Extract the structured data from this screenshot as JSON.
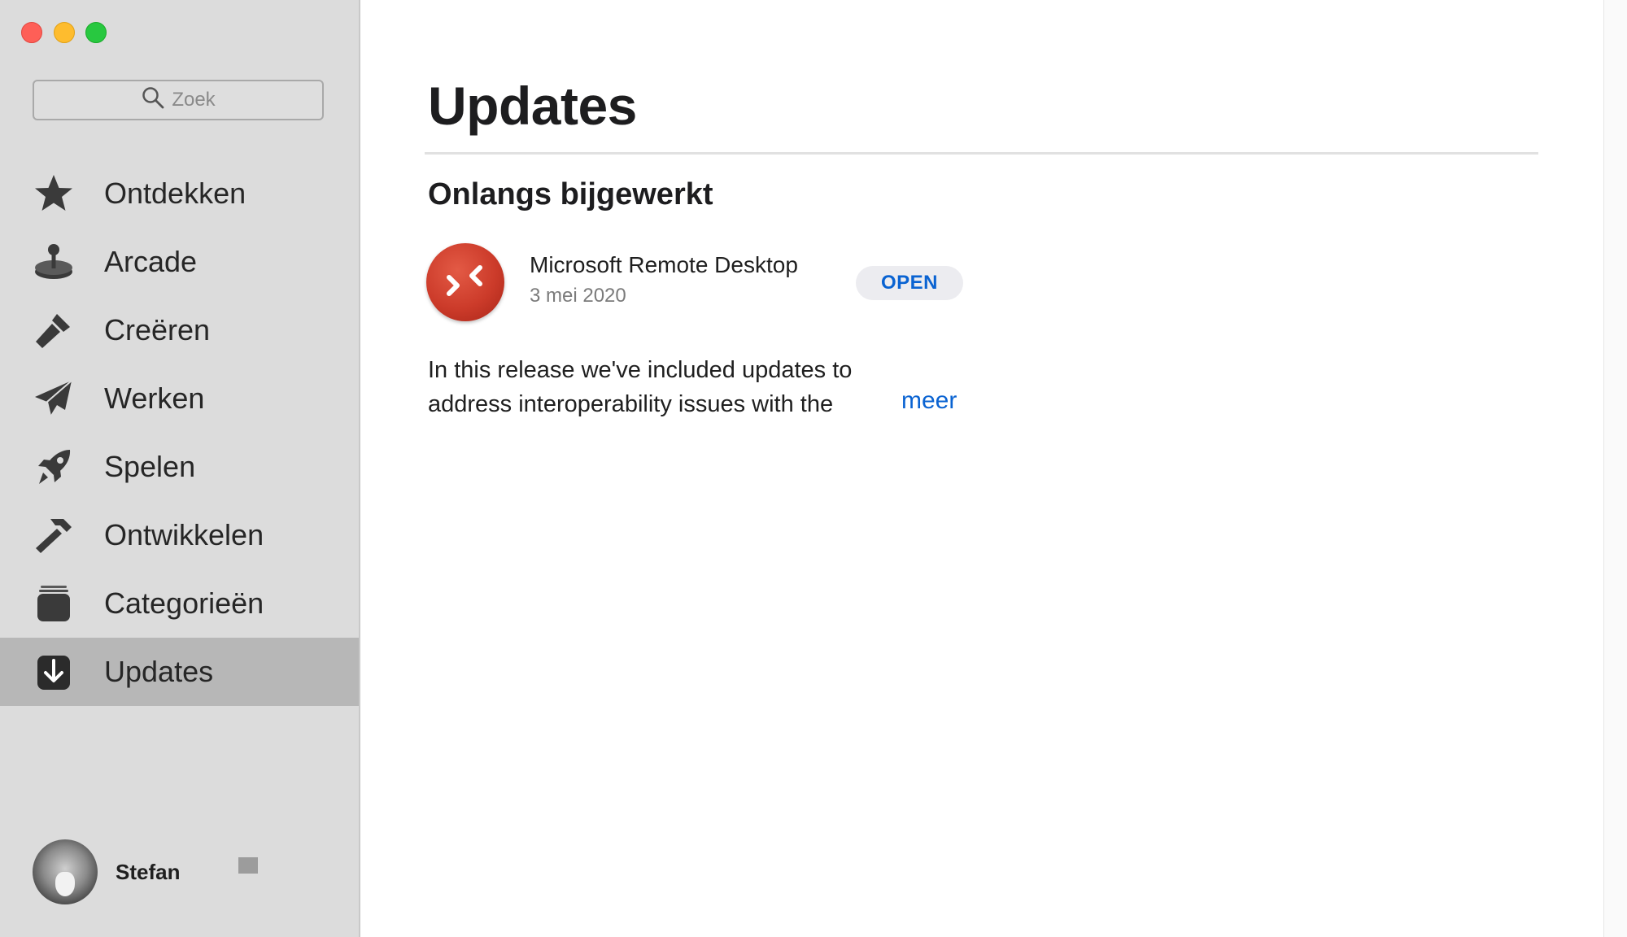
{
  "sidebar": {
    "search_placeholder": "Zoek",
    "items": [
      {
        "label": "Ontdekken",
        "icon": "star-icon"
      },
      {
        "label": "Arcade",
        "icon": "joystick-icon"
      },
      {
        "label": "Creëren",
        "icon": "brush-icon"
      },
      {
        "label": "Werken",
        "icon": "paper-plane-icon"
      },
      {
        "label": "Spelen",
        "icon": "rocket-icon"
      },
      {
        "label": "Ontwikkelen",
        "icon": "hammer-icon"
      },
      {
        "label": "Categorieën",
        "icon": "stack-icon"
      },
      {
        "label": "Updates",
        "icon": "download-icon",
        "active": true
      }
    ],
    "user": {
      "name": "Stefan"
    }
  },
  "main": {
    "title": "Updates",
    "section_title": "Onlangs bijgewerkt",
    "app": {
      "name": "Microsoft Remote Desktop",
      "date": "3 mei 2020",
      "open_label": "OPEN",
      "release_notes": "In this release we've included updates to address interoperability issues with the",
      "more_label": "meer"
    }
  },
  "colors": {
    "accent": "#0a63d2",
    "sidebar_bg": "#dcdcdc",
    "active_item_bg": "#b7b7b7",
    "app_icon": "#cc3b2a"
  }
}
